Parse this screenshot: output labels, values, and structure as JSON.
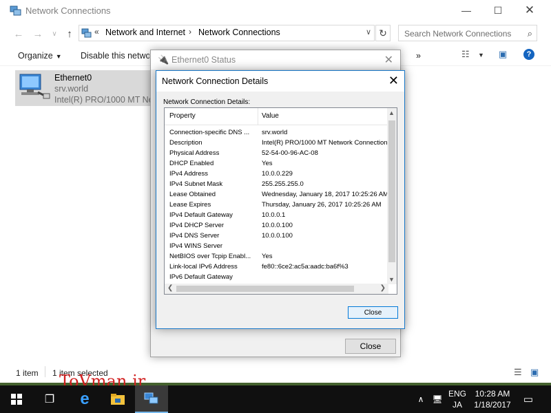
{
  "explorer": {
    "title": "Network Connections",
    "address": {
      "part1": "Network and Internet",
      "part2": "Network Connections",
      "prefix": "«",
      "sep": "›"
    },
    "search_placeholder": "Search Network Connections",
    "commands": {
      "organize": "Organize",
      "disable": "Disable this network device",
      "more": "»"
    },
    "item": {
      "name": "Ethernet0",
      "network": "srv.world",
      "adapter": "Intel(R) PRO/1000 MT Network Connection"
    },
    "status": {
      "count": "1 item",
      "selected": "1 item selected"
    }
  },
  "status_dialog": {
    "title": "Ethernet0 Status",
    "close_label": "Close"
  },
  "details_dialog": {
    "title": "Network Connection Details",
    "label": "Network Connection Details:",
    "col_property": "Property",
    "col_value": "Value",
    "rows": [
      {
        "property": "Connection-specific DNS ...",
        "value": "srv.world"
      },
      {
        "property": "Description",
        "value": "Intel(R) PRO/1000 MT Network Connection"
      },
      {
        "property": "Physical Address",
        "value": "52-54-00-96-AC-08"
      },
      {
        "property": "DHCP Enabled",
        "value": "Yes"
      },
      {
        "property": "IPv4 Address",
        "value": "10.0.0.229"
      },
      {
        "property": "IPv4 Subnet Mask",
        "value": "255.255.255.0"
      },
      {
        "property": "Lease Obtained",
        "value": "Wednesday, January 18, 2017 10:25:26 AM"
      },
      {
        "property": "Lease Expires",
        "value": "Thursday, January 26, 2017 10:25:26 AM"
      },
      {
        "property": "IPv4 Default Gateway",
        "value": "10.0.0.1"
      },
      {
        "property": "IPv4 DHCP Server",
        "value": "10.0.0.100"
      },
      {
        "property": "IPv4 DNS Server",
        "value": "10.0.0.100"
      },
      {
        "property": "IPv4 WINS Server",
        "value": ""
      },
      {
        "property": "NetBIOS over Tcpip Enabl...",
        "value": "Yes"
      },
      {
        "property": "Link-local IPv6 Address",
        "value": "fe80::6ce2:ac5a:aadc:ba6f%3"
      },
      {
        "property": "IPv6 Default Gateway",
        "value": ""
      }
    ],
    "close_label": "Close"
  },
  "watermark": "ToVman.ir",
  "taskbar": {
    "lang1": "ENG",
    "lang2": "JA",
    "time": "10:28 AM",
    "date": "1/18/2017"
  },
  "colors": {
    "accent": "#0078d7",
    "taskbar": "#101010",
    "watermark": "#d11f1f"
  }
}
